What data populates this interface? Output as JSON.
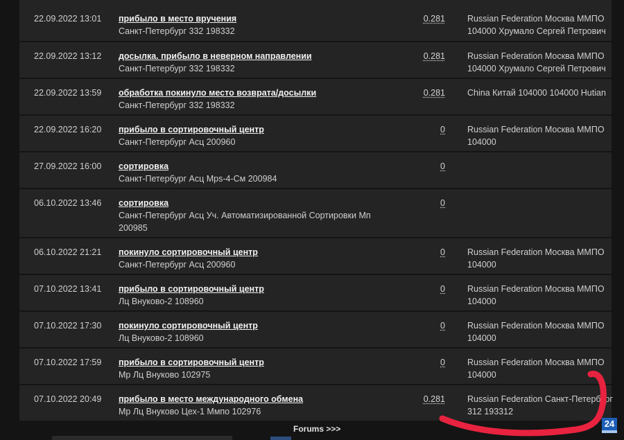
{
  "rows": [
    {
      "date": "22.09.2022 13:01",
      "status": "прибыло в место вручения",
      "place": "Санкт-Петербург 332 198332",
      "weight": "0.281",
      "destination": "Russian Federation Москва ММПО 104000 Хрумало Сергей Петрович"
    },
    {
      "date": "22.09.2022 13:12",
      "status": "досылка. прибыло в неверном направлении",
      "place": "Санкт-Петербург 332 198332",
      "weight": "0.281",
      "destination": "Russian Federation Москва ММПО 104000 Хрумало Сергей Петрович"
    },
    {
      "date": "22.09.2022 13:59",
      "status": "обработка покинуло место возврата/досылки",
      "place": "Санкт-Петербург 332 198332",
      "weight": "0.281",
      "destination": "China Китай 104000 104000 Hutian"
    },
    {
      "date": "22.09.2022 16:20",
      "status": "прибыло в сортировочный центр",
      "place": "Санкт-Петербург Асц 200960",
      "weight": "0",
      "destination": "Russian Federation Москва ММПО 104000"
    },
    {
      "date": "27.09.2022 16:00",
      "status": "сортировка",
      "place": "Санкт-Петербург Асц Mps-4-См 200984",
      "weight": "0",
      "destination": ""
    },
    {
      "date": "06.10.2022 13:46",
      "status": "сортировка",
      "place": "Санкт-Петербург Асц Уч. Автоматизированной Сортировки Мп 200985",
      "weight": "0",
      "destination": ""
    },
    {
      "date": "06.10.2022 21:21",
      "status": "покинуло сортировочный центр",
      "place": "Санкт-Петербург Асц 200960",
      "weight": "0",
      "destination": "Russian Federation Москва ММПО 104000"
    },
    {
      "date": "07.10.2022 13:41",
      "status": "прибыло в сортировочный центр",
      "place": "Лц Внуково-2 108960",
      "weight": "0",
      "destination": "Russian Federation Москва ММПО 104000"
    },
    {
      "date": "07.10.2022 17:30",
      "status": "покинуло сортировочный центр",
      "place": "Лц Внуково-2 108960",
      "weight": "0",
      "destination": "Russian Federation Москва ММПО 104000"
    },
    {
      "date": "07.10.2022 17:59",
      "status": "прибыло в сортировочный центр",
      "place": "Мр Лц Внуково 102975",
      "weight": "0",
      "destination": "Russian Federation Москва ММПО 104000"
    },
    {
      "date": "07.10.2022 20:49",
      "status": "прибыло в место международного обмена",
      "place": "Мр Лц Внуково Цех-1 Ммпо 102976",
      "weight": "0.281",
      "destination": "Russian Federation Санкт-Петербург 312 193312"
    }
  ],
  "forums_link": "Forums >>>",
  "badge": "24",
  "colors": {
    "background": "#141414",
    "row": "#242424",
    "annotation": "#e8233f",
    "badge": "#1d5fb8"
  }
}
